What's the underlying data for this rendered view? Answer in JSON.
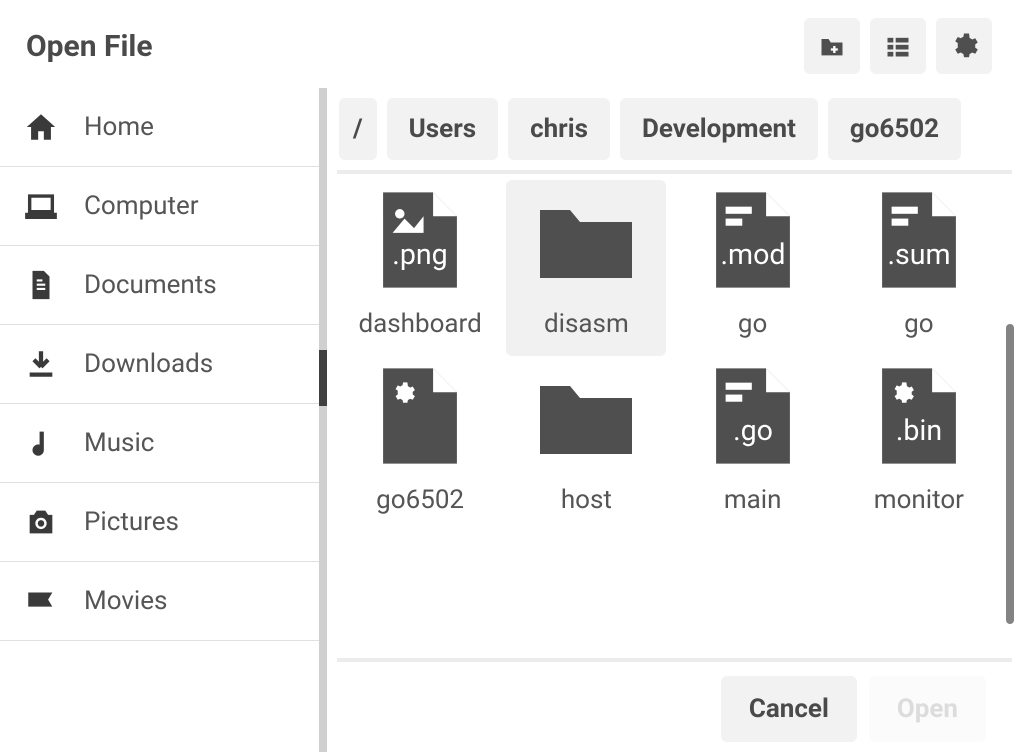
{
  "title": "Open File",
  "sidebar": {
    "items": [
      {
        "label": "Home",
        "icon": "home"
      },
      {
        "label": "Computer",
        "icon": "laptop"
      },
      {
        "label": "Documents",
        "icon": "document"
      },
      {
        "label": "Downloads",
        "icon": "download"
      },
      {
        "label": "Music",
        "icon": "music"
      },
      {
        "label": "Pictures",
        "icon": "camera"
      },
      {
        "label": "Movies",
        "icon": "movie"
      }
    ]
  },
  "breadcrumbs": [
    "/",
    "Users",
    "chris",
    "Development",
    "go6502"
  ],
  "files": [
    {
      "name": "dashboard",
      "type": "image",
      "ext": ".png",
      "selected": false
    },
    {
      "name": "disasm",
      "type": "folder",
      "ext": "",
      "selected": true
    },
    {
      "name": "go",
      "type": "file",
      "ext": ".mod",
      "selected": false
    },
    {
      "name": "go",
      "type": "file",
      "ext": ".sum",
      "selected": false
    },
    {
      "name": "go6502",
      "type": "config",
      "ext": "",
      "selected": false
    },
    {
      "name": "host",
      "type": "folder",
      "ext": "",
      "selected": false
    },
    {
      "name": "main",
      "type": "file",
      "ext": ".go",
      "selected": false
    },
    {
      "name": "monitor",
      "type": "config",
      "ext": ".bin",
      "selected": false
    }
  ],
  "actions": {
    "cancel": "Cancel",
    "open": "Open",
    "open_enabled": false
  }
}
